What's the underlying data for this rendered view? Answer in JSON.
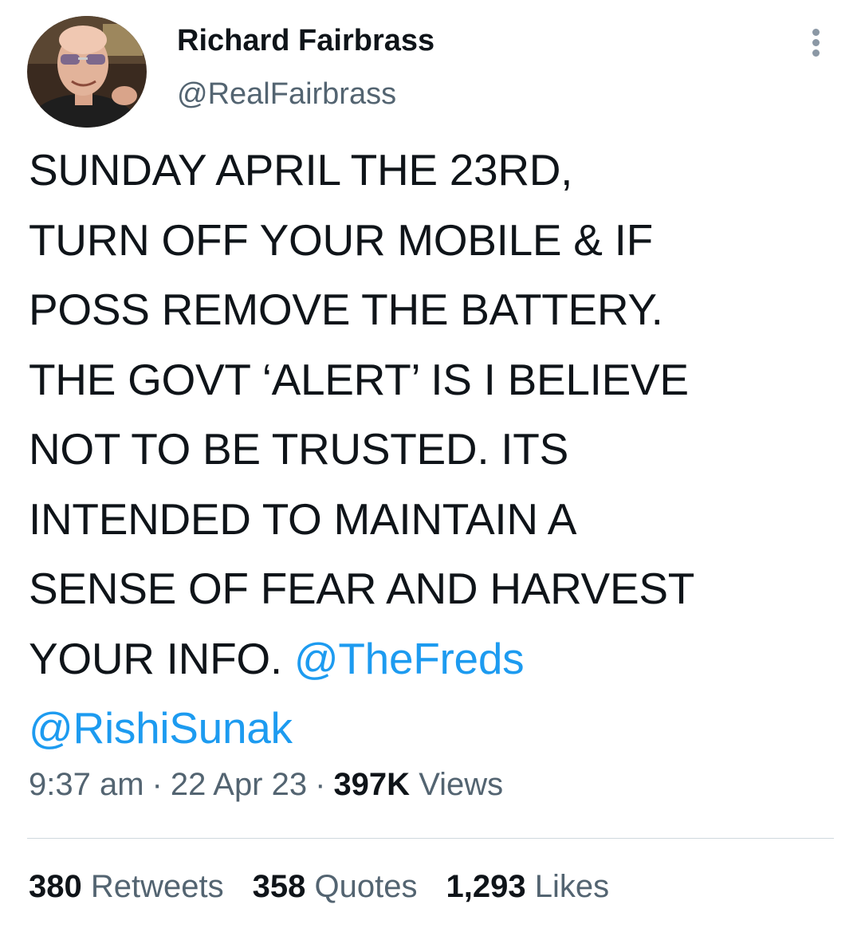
{
  "author": {
    "display_name": "Richard Fairbrass",
    "handle": "@RealFairbrass"
  },
  "tweet": {
    "lines": [
      "SUNDAY APRIL THE 23RD,",
      "TURN OFF YOUR MOBILE & IF",
      "POSS REMOVE THE BATTERY.",
      "THE GOVT ‘ALERT’ IS I BELIEVE",
      "NOT TO BE TRUSTED. ITS",
      "INTENDED TO MAINTAIN A",
      "SENSE OF FEAR AND HARVEST"
    ],
    "last_line_text": "YOUR INFO. ",
    "mentions": [
      "@TheFreds",
      "@RishiSunak"
    ]
  },
  "meta": {
    "time": "9:37 am",
    "date": "22 Apr 23",
    "separator": "·",
    "views_count": "397K",
    "views_label": "Views"
  },
  "stats": {
    "retweets": {
      "count": "380",
      "label": "Retweets"
    },
    "quotes": {
      "count": "358",
      "label": "Quotes"
    },
    "likes": {
      "count": "1,293",
      "label": "Likes"
    }
  },
  "icons": {
    "more": "more-vertical-icon"
  },
  "colors": {
    "text": "#0f1419",
    "secondary": "#536471",
    "link": "#1d9bf0",
    "divider": "#cfd9de"
  }
}
